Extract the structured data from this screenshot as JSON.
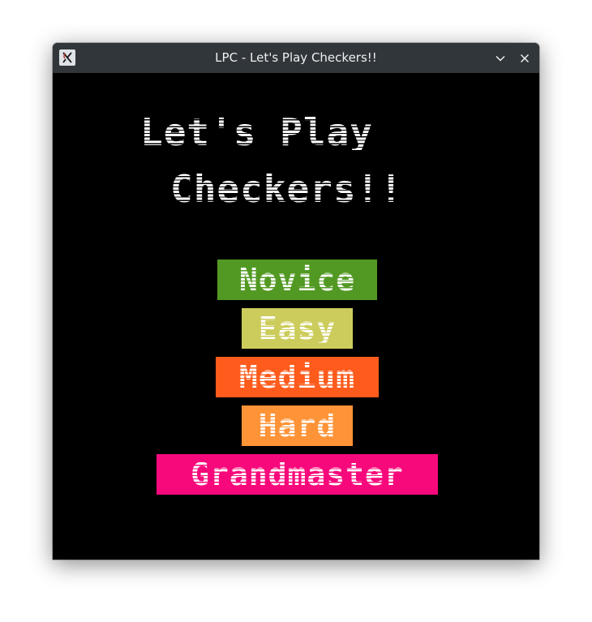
{
  "window": {
    "title": "LPC - Let's Play Checkers!!"
  },
  "heading": {
    "line1": "Let's Play",
    "line2": "Checkers!!"
  },
  "difficulty": [
    {
      "label": "Novice",
      "color": "#529923"
    },
    {
      "label": "Easy",
      "color": "#cccc5c"
    },
    {
      "label": "Medium",
      "color": "#fe5b1c"
    },
    {
      "label": "Hard",
      "color": "#fe9337"
    },
    {
      "label": "Grandmaster",
      "color": "#f7097b"
    }
  ],
  "icons": {
    "app": "app-logo-icon",
    "minimize": "chevron-down-icon",
    "close": "close-icon"
  }
}
